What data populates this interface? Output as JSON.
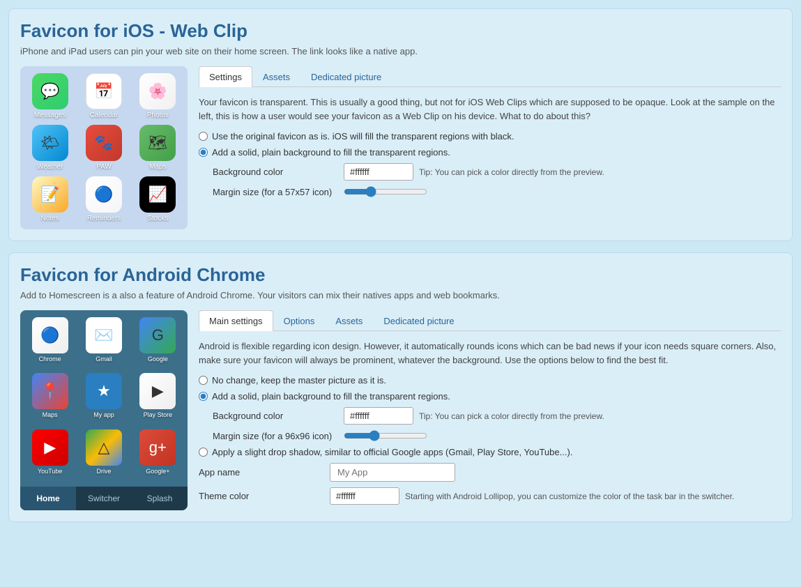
{
  "ios_section": {
    "title": "Favicon for iOS - Web Clip",
    "subtitle": "iPhone and iPad users can pin your web site on their home screen. The link looks like a native app.",
    "tabs": [
      "Settings",
      "Assets",
      "Dedicated picture"
    ],
    "active_tab": "Settings",
    "description": "Your favicon is transparent. This is usually a good thing, but not for iOS Web Clips which are supposed to be opaque. Look at the sample on the left, this is how a user would see your favicon as a Web Clip on his device. What to do about this?",
    "radio_options": [
      "Use the original favicon as is. iOS will fill the transparent regions with black.",
      "Add a solid, plain background to fill the transparent regions."
    ],
    "selected_radio": 1,
    "background_color_label": "Background color",
    "background_color_value": "#ffffff",
    "tip_text": "Tip: You can pick a color directly from the preview.",
    "margin_label": "Margin size (for a 57x57 icon)",
    "ios_apps": [
      {
        "label": "Messages",
        "emoji": "💬",
        "class": "ic-messages"
      },
      {
        "label": "Calendar",
        "emoji": "📅",
        "class": "ic-calendar"
      },
      {
        "label": "Photos",
        "emoji": "🌸",
        "class": "ic-photos"
      },
      {
        "label": "Weather",
        "emoji": "🌤",
        "class": "ic-weather"
      },
      {
        "label": "PAW",
        "emoji": "🐾",
        "class": "ic-paw"
      },
      {
        "label": "Maps",
        "emoji": "🗺",
        "class": "ic-maps"
      },
      {
        "label": "Notes",
        "emoji": "📝",
        "class": "ic-notes"
      },
      {
        "label": "Reminders",
        "emoji": "🔵",
        "class": "ic-reminders"
      },
      {
        "label": "Stocks",
        "emoji": "📈",
        "class": "ic-stocks"
      }
    ]
  },
  "android_section": {
    "title": "Favicon for Android Chrome",
    "subtitle": "Add to Homescreen is a also a feature of Android Chrome. Your visitors can mix their natives apps and web bookmarks.",
    "tabs": [
      "Main settings",
      "Options",
      "Assets",
      "Dedicated picture"
    ],
    "active_tab": "Main settings",
    "description": "Android is flexible regarding icon design. However, it automatically rounds icons which can be bad news if your icon needs square corners. Also, make sure your favicon will always be prominent, whatever the background. Use the options below to find the best fit.",
    "radio_options": [
      "No change, keep the master picture as it is.",
      "Add a solid, plain background to fill the transparent regions."
    ],
    "selected_radio": 1,
    "background_color_label": "Background color",
    "background_color_value": "#ffffff",
    "tip_text": "Tip: You can pick a color directly from the preview.",
    "margin_label": "Margin size (for a 96x96 icon)",
    "shadow_label": "Apply a slight drop shadow, similar to official Google apps (Gmail, Play Store, YouTube...).",
    "app_name_label": "App name",
    "app_name_placeholder": "My App",
    "theme_color_label": "Theme color",
    "theme_color_value": "#ffffff",
    "theme_color_tip": "Starting with Android Lollipop, you can customize the color of the task bar in the switcher.",
    "taskbar": [
      "Home",
      "Switcher",
      "Splash"
    ],
    "active_taskbar": "Home",
    "android_apps": [
      {
        "label": "Chrome",
        "emoji": "🔵",
        "class": "ic-chrome"
      },
      {
        "label": "Gmail",
        "emoji": "✉️",
        "class": "ic-gmail"
      },
      {
        "label": "Google",
        "emoji": "G",
        "class": "ic-google"
      },
      {
        "label": "Maps",
        "emoji": "📍",
        "class": "ic-gmaps"
      },
      {
        "label": "My app",
        "emoji": "★",
        "class": "ic-myapp"
      },
      {
        "label": "Play Store",
        "emoji": "▶",
        "class": "ic-playstore"
      },
      {
        "label": "YouTube",
        "emoji": "▶",
        "class": "ic-youtube"
      },
      {
        "label": "Drive",
        "emoji": "△",
        "class": "ic-drive"
      },
      {
        "label": "Google+",
        "emoji": "g+",
        "class": "ic-gplus"
      }
    ]
  }
}
